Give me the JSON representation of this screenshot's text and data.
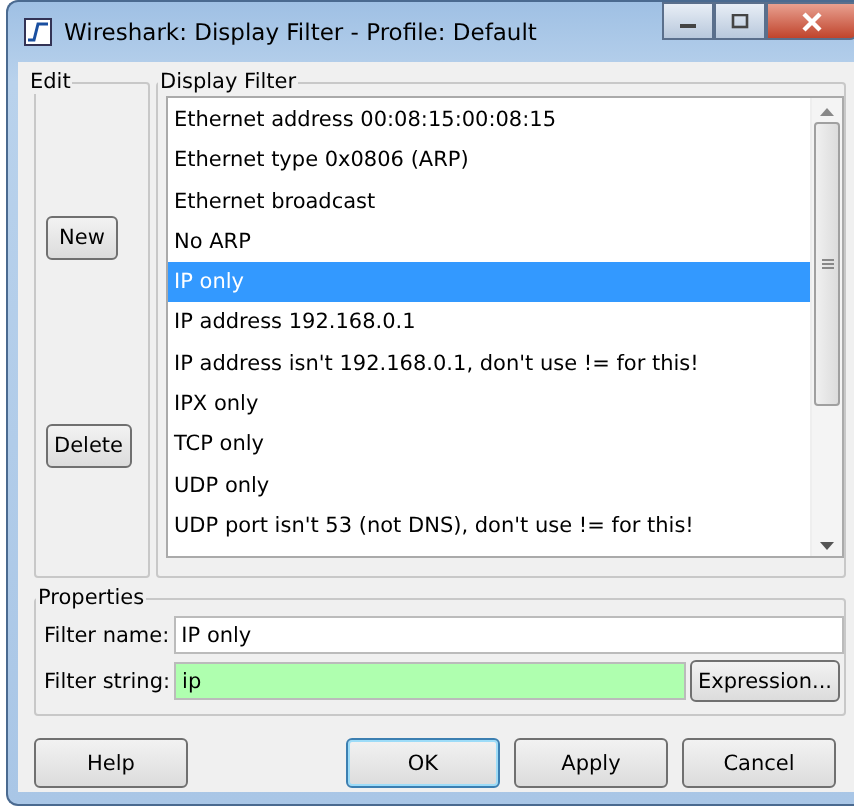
{
  "window": {
    "title": "Wireshark: Display Filter - Profile: Default"
  },
  "edit": {
    "title": "Edit",
    "buttons": [
      "New",
      "Delete"
    ]
  },
  "display_filter": {
    "title": "Display Filter",
    "items": [
      {
        "label": "Ethernet address 00:08:15:00:08:15",
        "selected": false
      },
      {
        "label": "Ethernet type 0x0806 (ARP)",
        "selected": false
      },
      {
        "label": "Ethernet broadcast",
        "selected": false
      },
      {
        "label": "No ARP",
        "selected": false
      },
      {
        "label": "IP only",
        "selected": true
      },
      {
        "label": "IP address 192.168.0.1",
        "selected": false
      },
      {
        "label": "IP address isn't 192.168.0.1, don't use != for this!",
        "selected": false
      },
      {
        "label": "IPX only",
        "selected": false
      },
      {
        "label": "TCP only",
        "selected": false
      },
      {
        "label": "UDP only",
        "selected": false
      },
      {
        "label": "UDP port isn't 53 (not DNS), don't use != for this!",
        "selected": false
      }
    ]
  },
  "properties": {
    "title": "Properties",
    "filter_name_label": "Filter name:",
    "filter_name": "IP only",
    "filter_string_label": "Filter string:",
    "filter_string": "ip",
    "filter_string_valid": true,
    "expression_button": "Expression..."
  },
  "buttons": [
    {
      "label": "Help",
      "default": false
    },
    {
      "label": "OK",
      "default": true
    },
    {
      "label": "Apply",
      "default": false
    },
    {
      "label": "Cancel",
      "default": false
    }
  ]
}
